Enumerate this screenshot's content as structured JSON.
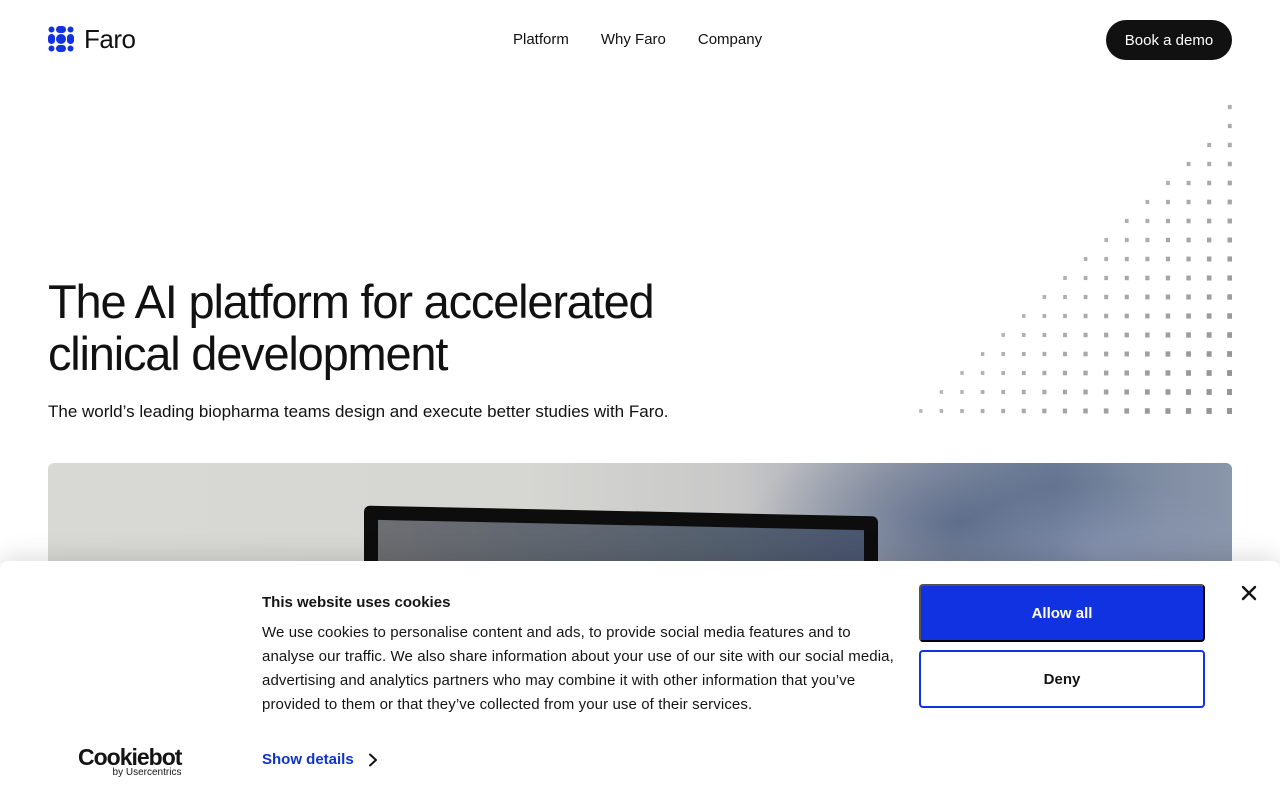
{
  "header": {
    "brand": "Faro",
    "nav": [
      "Platform",
      "Why Faro",
      "Company"
    ],
    "cta": "Book a demo"
  },
  "hero": {
    "title_line1": "The AI platform for accelerated",
    "title_line2": "clinical development",
    "subtitle": "The world’s leading biopharma teams design and execute better studies with Faro."
  },
  "cookie_banner": {
    "title": "This website uses cookies",
    "body": "We use cookies to personalise content and ads, to provide social media features and to analyse our traffic. We also share information about your use of our site with our social media, advertising and analytics partners who may combine it with other information that you’ve provided to them or that they’ve collected from your use of their services.",
    "show_details": "Show details",
    "allow_all": "Allow all",
    "deny": "Deny",
    "provider": "Cookiebot",
    "provider_sub": "by Usercentrics"
  },
  "colors": {
    "brand_blue": "#1032e0",
    "dark": "#111111",
    "link_blue": "#1032cf"
  },
  "icons": {
    "logo": "faro-logo-icon",
    "close": "close-icon",
    "chevron": "chevron-right-icon"
  }
}
